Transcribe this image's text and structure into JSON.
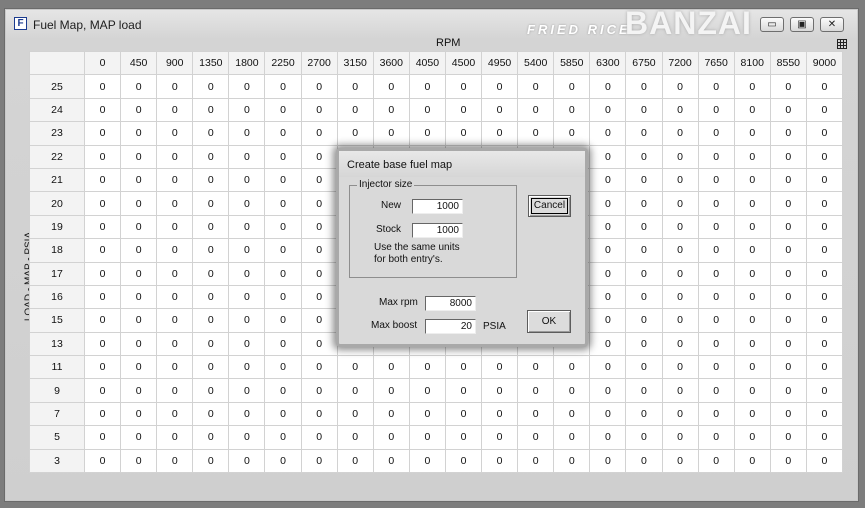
{
  "window": {
    "title": "Fuel Map, MAP load",
    "app_icon_letter": "F",
    "watermark_small": "FRIED RICE",
    "watermark_big": "BANZAI",
    "caption_minimize": "▭",
    "caption_maximize": "▣",
    "caption_close": "✕"
  },
  "grid": {
    "x_axis_label": "RPM",
    "y_axis_label": "LOAD - MAP - PSIA",
    "rpm_columns": [
      "0",
      "450",
      "900",
      "1350",
      "1800",
      "2250",
      "2700",
      "3150",
      "3600",
      "4050",
      "4500",
      "4950",
      "5400",
      "5850",
      "6300",
      "6750",
      "7200",
      "7650",
      "8100",
      "8550",
      "9000"
    ],
    "load_rows": [
      "25",
      "24",
      "23",
      "22",
      "21",
      "20",
      "19",
      "18",
      "17",
      "16",
      "15",
      "13",
      "11",
      "9",
      "7",
      "5",
      "3"
    ],
    "cell_value": "0"
  },
  "dialog": {
    "title": "Create base fuel map",
    "injector_group_label": "Injector size",
    "new_label": "New",
    "new_value": "1000",
    "stock_label": "Stock",
    "stock_value": "1000",
    "note_line1": "Use the same units",
    "note_line2": "for both entry's.",
    "max_rpm_label": "Max rpm",
    "max_rpm_value": "8000",
    "max_boost_label": "Max boost",
    "max_boost_value": "20",
    "boost_unit": "PSIA",
    "cancel_label": "Cancel",
    "ok_label": "OK"
  }
}
